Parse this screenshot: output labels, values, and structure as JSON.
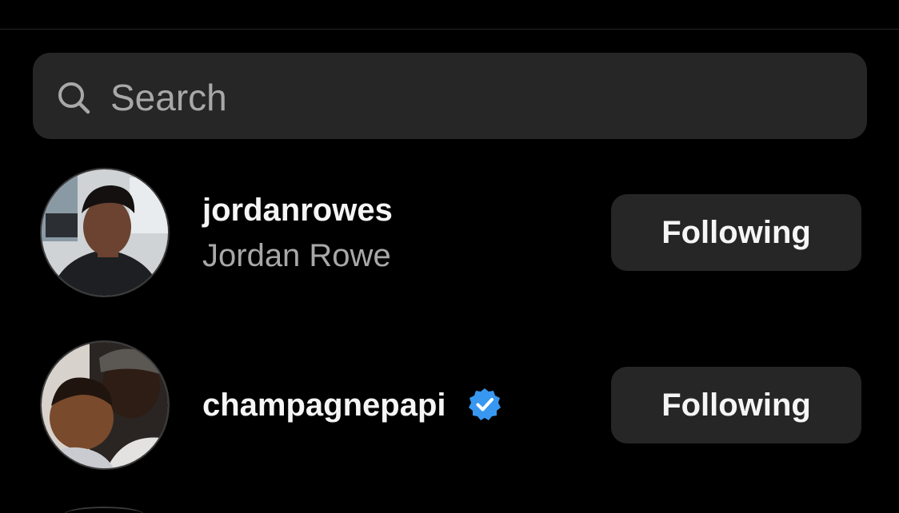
{
  "search": {
    "placeholder": "Search",
    "icon": "search-icon"
  },
  "users": [
    {
      "username": "jordanrowes",
      "full_name": "Jordan Rowe",
      "verified": false,
      "button_label": "Following",
      "avatar": "avatar-photo"
    },
    {
      "username": "champagnepapi",
      "full_name": "",
      "verified": true,
      "button_label": "Following",
      "avatar": "avatar-photo"
    }
  ],
  "colors": {
    "background": "#000000",
    "surface": "#262626",
    "primary_text": "#f5f5f5",
    "secondary_text": "#a8a8a8",
    "verified_blue": "#3897f0"
  }
}
